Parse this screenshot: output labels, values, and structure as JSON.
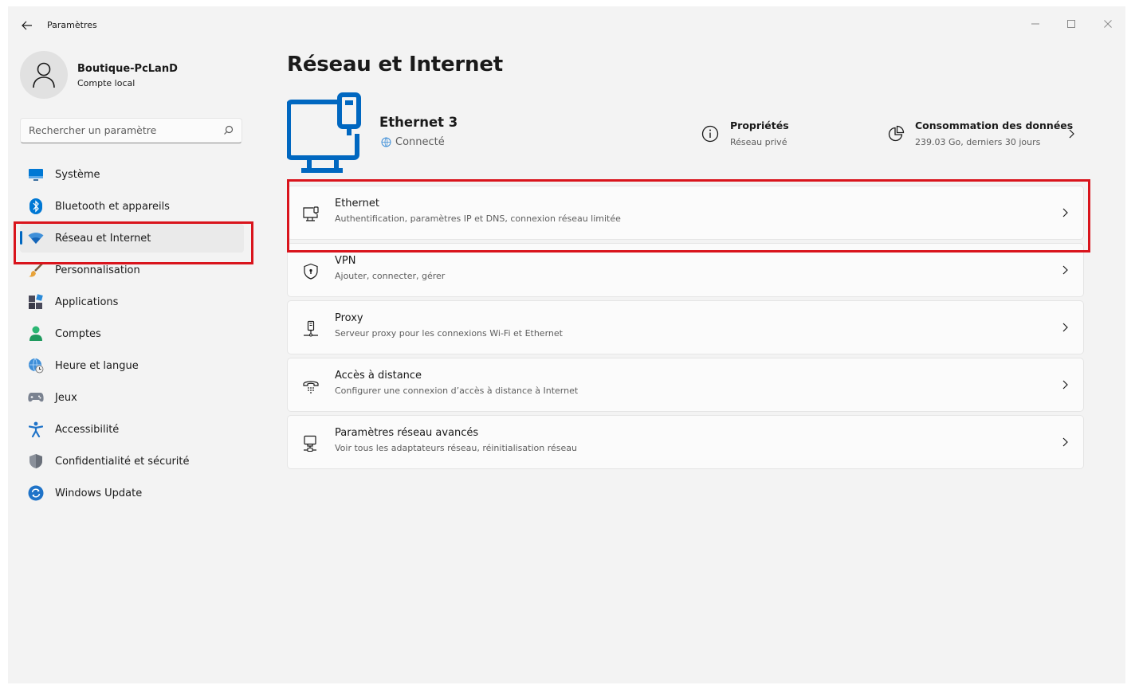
{
  "app": {
    "title": "Paramètres"
  },
  "user": {
    "name": "Boutique-PcLanD",
    "account_type": "Compte local"
  },
  "search": {
    "placeholder": "Rechercher un paramètre"
  },
  "sidebar": {
    "items": [
      {
        "label": "Système",
        "icon": "system-icon"
      },
      {
        "label": "Bluetooth et appareils",
        "icon": "bluetooth-icon"
      },
      {
        "label": "Réseau et Internet",
        "icon": "wifi-icon",
        "active": true
      },
      {
        "label": "Personnalisation",
        "icon": "brush-icon"
      },
      {
        "label": "Applications",
        "icon": "apps-icon"
      },
      {
        "label": "Comptes",
        "icon": "person-icon"
      },
      {
        "label": "Heure et langue",
        "icon": "globe-clock-icon"
      },
      {
        "label": "Jeux",
        "icon": "gamepad-icon"
      },
      {
        "label": "Accessibilité",
        "icon": "accessibility-icon"
      },
      {
        "label": "Confidentialité et sécurité",
        "icon": "shield-icon"
      },
      {
        "label": "Windows Update",
        "icon": "update-icon"
      }
    ]
  },
  "main": {
    "title": "Réseau et Internet",
    "adapter": {
      "name": "Ethernet 3",
      "status": "Connecté"
    },
    "properties": {
      "title": "Propriétés",
      "subtitle": "Réseau privé"
    },
    "data_usage": {
      "title": "Consommation des données",
      "subtitle": "239.03 Go, derniers 30 jours"
    },
    "cards": [
      {
        "title": "Ethernet",
        "subtitle": "Authentification, paramètres IP et DNS, connexion réseau limitée",
        "icon": "ethernet-icon"
      },
      {
        "title": "VPN",
        "subtitle": "Ajouter, connecter, gérer",
        "icon": "vpn-shield-icon"
      },
      {
        "title": "Proxy",
        "subtitle": "Serveur proxy pour les connexions Wi-Fi et Ethernet",
        "icon": "proxy-icon"
      },
      {
        "title": "Accès à distance",
        "subtitle": "Configurer une connexion d’accès à distance à Internet",
        "icon": "dialup-icon"
      },
      {
        "title": "Paramètres réseau avancés",
        "subtitle": "Voir tous les adaptateurs réseau, réinitialisation réseau",
        "icon": "network-adapter-icon"
      }
    ]
  },
  "colors": {
    "accent": "#0067c0",
    "highlight": "#d9141c",
    "background": "#f3f3f3",
    "card": "#fbfbfb"
  }
}
